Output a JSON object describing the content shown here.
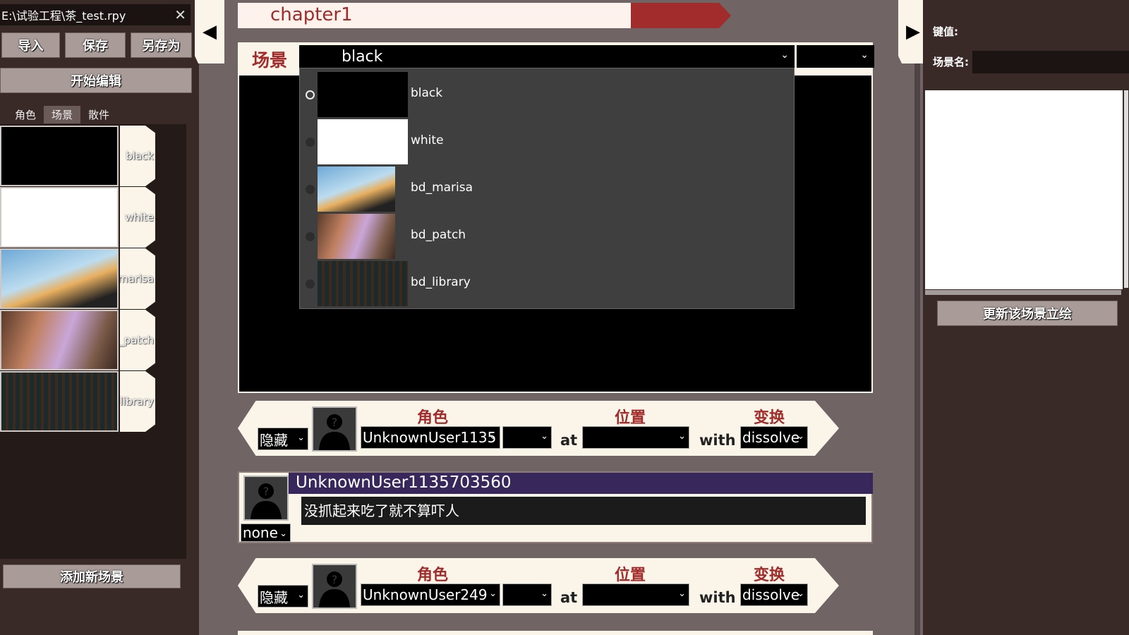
{
  "left_panel": {
    "file_tab": "E:\\试验工程\\茶_test.rpy",
    "close_glyph": "✕",
    "import_label": "导入",
    "save_label": "保存",
    "save_as_label": "另存为",
    "start_edit_label": "开始编辑",
    "tabs": [
      "角色",
      "场景",
      "散件"
    ],
    "active_tab": "场景",
    "scenes": [
      {
        "tag": "black",
        "thumb_color": "#000000"
      },
      {
        "tag": "white",
        "thumb_color": "#ffffff"
      },
      {
        "tag": "marisa",
        "thumb_color": "#8ab8d8"
      },
      {
        "tag": "_patch",
        "thumb_color": "#6b4a3c"
      },
      {
        "tag": "library",
        "thumb_color": "#2a2020"
      }
    ],
    "add_scene_label": "添加新场景"
  },
  "arrows": {
    "left_glyph": "◀",
    "right_glyph": "▶"
  },
  "chapter": {
    "title": "chapter1"
  },
  "scene_panel": {
    "label": "场景",
    "selected": "black",
    "chevron": "⌄",
    "options": [
      {
        "label": "black",
        "selected": true
      },
      {
        "label": "white",
        "selected": false
      },
      {
        "label": "bd_marisa",
        "selected": false
      },
      {
        "label": "bd_patch",
        "selected": false
      },
      {
        "label": "bd_library",
        "selected": false
      }
    ]
  },
  "character_rows": [
    {
      "visibility": "隐藏",
      "character_head": "角色",
      "character": "UnknownUser1135",
      "position_head": "位置",
      "at_word": "at",
      "with_word": "with",
      "transform_head": "变换",
      "transform": "dissolve"
    },
    {
      "visibility": "隐藏",
      "character_head": "角色",
      "character": "UnknownUser249",
      "position_head": "位置",
      "at_word": "at",
      "with_word": "with",
      "transform_head": "变换",
      "transform": "dissolve"
    }
  ],
  "dialogue": {
    "speaker": "UnknownUser1135703560",
    "text": "没抓起来吃了就不算吓人",
    "expression": "none"
  },
  "right_panel": {
    "key_label": "键值:",
    "scene_name_label": "场景名:",
    "update_label": "更新该场景立绘"
  },
  "colors": {
    "accent_red": "#a12c2b",
    "cream": "#fbf5e9",
    "panel_dark": "#3a2a27",
    "name_bar": "#37275a"
  }
}
